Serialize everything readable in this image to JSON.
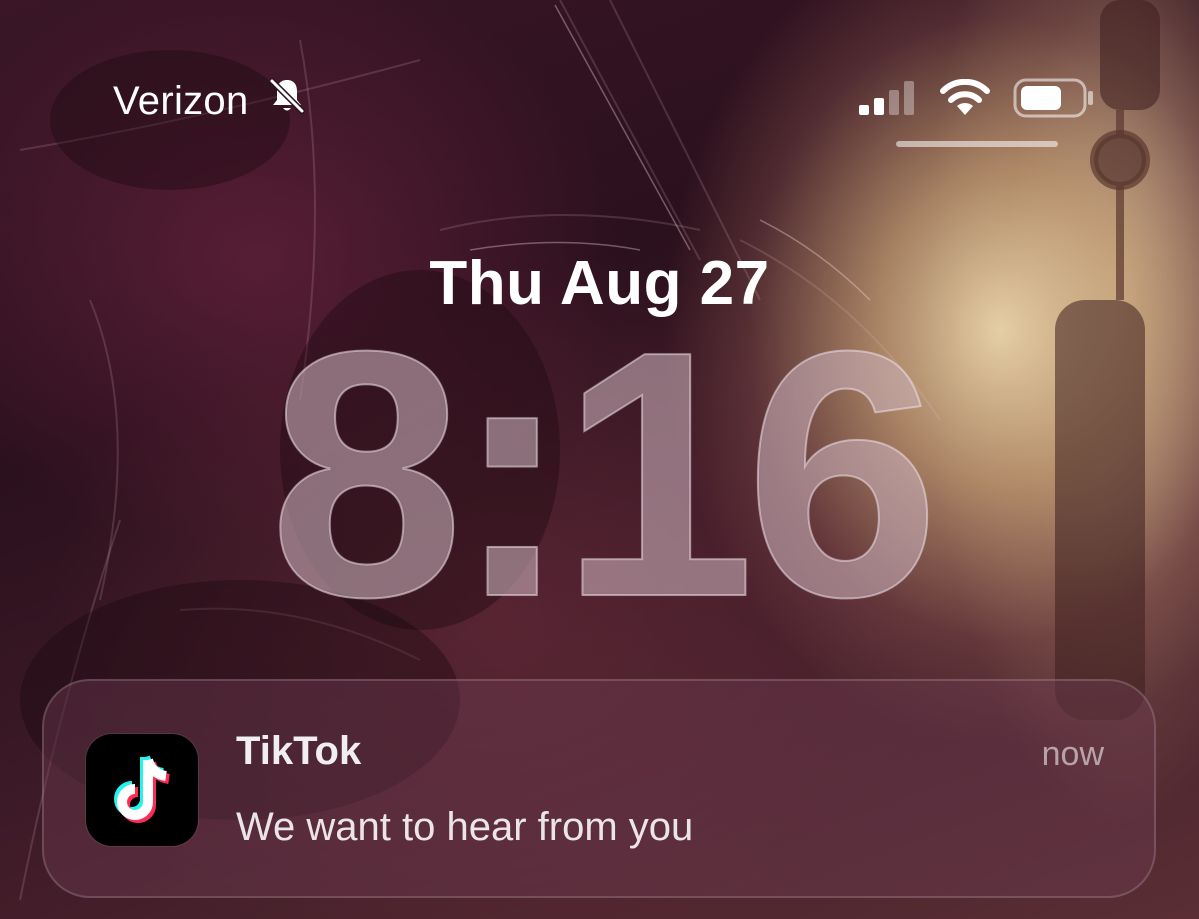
{
  "status_bar": {
    "carrier": "Verizon",
    "silent_icon": "bell-slash-icon",
    "signal_icon": "cellular-signal-icon",
    "wifi_icon": "wifi-icon",
    "battery_icon": "battery-icon",
    "signal_bars_active": 2,
    "signal_bars_total": 4
  },
  "lock_screen": {
    "date": "Thu Aug 27",
    "time": "8:16"
  },
  "notification": {
    "app_icon": "tiktok-icon",
    "app_name": "TikTok",
    "time": "now",
    "message": "We want to hear from you"
  },
  "colors": {
    "tiktok_cyan": "#25F4EE",
    "tiktok_red": "#FE2C55"
  }
}
